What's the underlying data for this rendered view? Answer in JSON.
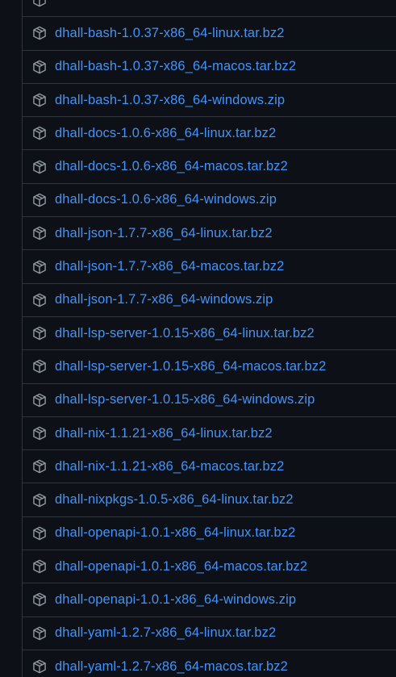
{
  "assets": [
    {
      "name": "",
      "icon": "package-icon"
    },
    {
      "name": "dhall-bash-1.0.37-x86_64-linux.tar.bz2",
      "icon": "package-icon"
    },
    {
      "name": "dhall-bash-1.0.37-x86_64-macos.tar.bz2",
      "icon": "package-icon"
    },
    {
      "name": "dhall-bash-1.0.37-x86_64-windows.zip",
      "icon": "package-icon"
    },
    {
      "name": "dhall-docs-1.0.6-x86_64-linux.tar.bz2",
      "icon": "package-icon"
    },
    {
      "name": "dhall-docs-1.0.6-x86_64-macos.tar.bz2",
      "icon": "package-icon"
    },
    {
      "name": "dhall-docs-1.0.6-x86_64-windows.zip",
      "icon": "package-icon"
    },
    {
      "name": "dhall-json-1.7.7-x86_64-linux.tar.bz2",
      "icon": "package-icon"
    },
    {
      "name": "dhall-json-1.7.7-x86_64-macos.tar.bz2",
      "icon": "package-icon"
    },
    {
      "name": "dhall-json-1.7.7-x86_64-windows.zip",
      "icon": "package-icon"
    },
    {
      "name": "dhall-lsp-server-1.0.15-x86_64-linux.tar.bz2",
      "icon": "package-icon"
    },
    {
      "name": "dhall-lsp-server-1.0.15-x86_64-macos.tar.bz2",
      "icon": "package-icon"
    },
    {
      "name": "dhall-lsp-server-1.0.15-x86_64-windows.zip",
      "icon": "package-icon"
    },
    {
      "name": "dhall-nix-1.1.21-x86_64-linux.tar.bz2",
      "icon": "package-icon"
    },
    {
      "name": "dhall-nix-1.1.21-x86_64-macos.tar.bz2",
      "icon": "package-icon"
    },
    {
      "name": "dhall-nixpkgs-1.0.5-x86_64-linux.tar.bz2",
      "icon": "package-icon"
    },
    {
      "name": "dhall-openapi-1.0.1-x86_64-linux.tar.bz2",
      "icon": "package-icon"
    },
    {
      "name": "dhall-openapi-1.0.1-x86_64-macos.tar.bz2",
      "icon": "package-icon"
    },
    {
      "name": "dhall-openapi-1.0.1-x86_64-windows.zip",
      "icon": "package-icon"
    },
    {
      "name": "dhall-yaml-1.2.7-x86_64-linux.tar.bz2",
      "icon": "package-icon"
    },
    {
      "name": "dhall-yaml-1.2.7-x86_64-macos.tar.bz2",
      "icon": "package-icon"
    }
  ],
  "colors": {
    "background": "#0d1117",
    "border": "#30363d",
    "link": "#4493f8",
    "icon": "#9198a1"
  }
}
